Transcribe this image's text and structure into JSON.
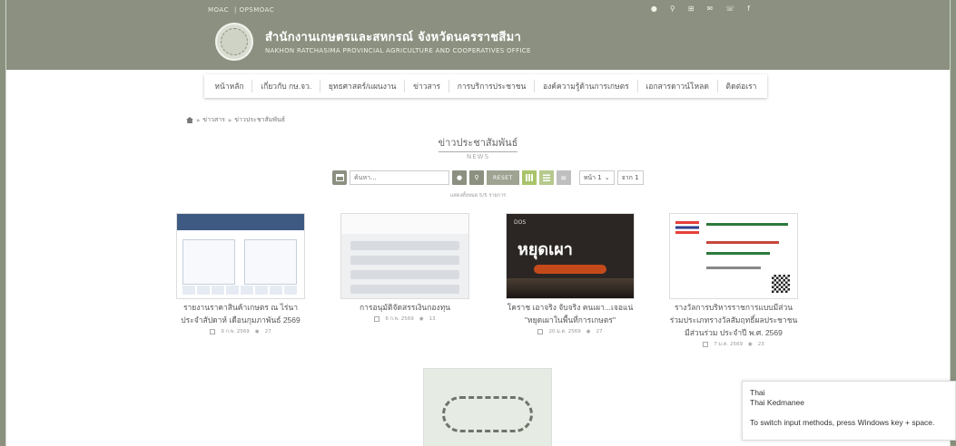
{
  "header": {
    "top_links": [
      "MOAC",
      "OPSMOAC"
    ],
    "title": "สำนักงานเกษตรและสหกรณ์ จังหวัดนครราชสีมา",
    "subtitle": "NAKHON RATCHASIMA PROVINCIAL AGRICULTURE AND COOPERATIVES OFFICE"
  },
  "nav": {
    "items": [
      "หน้าหลัก",
      "เกี่ยวกับ กษ.จว.",
      "ยุทธศาสตร์/แผนงาน",
      "ข่าวสาร",
      "การบริการประชาชน",
      "องค์ความรู้ด้านการเกษตร",
      "เอกสารดาวน์โหลด",
      "ติดต่อเรา"
    ]
  },
  "breadcrumb": {
    "items": [
      "ข่าวสาร",
      "ข่าวประชาสัมพันธ์"
    ]
  },
  "section": {
    "title": "ข่าวประชาสัมพันธ์",
    "subtitle": "NEWS"
  },
  "filters": {
    "search_placeholder": "ค้นหา...",
    "reset_label": "RESET",
    "page_select": "หน้า 1",
    "page_total": "จาก 1",
    "count_text": "แสดงทั้งหมด 5/5 รายการ"
  },
  "cards": [
    {
      "title_line1": "รายงานราคาสินค้าเกษตร ณ ไร่นา",
      "title_line2": "ประจำสัปดาห์ เดือนกุมภาพันธ์ 2569",
      "title_line3": "",
      "date": "9 ก.พ. 2569",
      "views": "27"
    },
    {
      "title_line1": "การอนุมัติจัดสรรเงินกองทุน",
      "title_line2": "",
      "title_line3": "",
      "date": "6 ก.พ. 2569",
      "views": "13"
    },
    {
      "title_line1": "โคราช เอาจริง จับจริง คนเผา...เจอแน่",
      "title_line2": "\"หยุดเผาในพื้นที่การเกษตร\"",
      "title_line3": "",
      "date": "20 ม.ค. 2569",
      "views": "27"
    },
    {
      "title_line1": "รางวัลการบริหารราชการแบบมีส่วน",
      "title_line2": "ร่วมประเภทรางวัลสัมฤทธิ์ผลประชาชน",
      "title_line3": "มีส่วนร่วม ประจำปี พ.ศ. 2569",
      "date": "7 ม.ค. 2569",
      "views": "23"
    }
  ],
  "card3_overlay": {
    "headline": "หยุดเผา",
    "badge": "DOS"
  },
  "ime_popup": {
    "line1": "Thai",
    "line2": "Thai Kedmanee",
    "line3": "To switch input methods, press Windows key + space."
  },
  "colors": {
    "header_bg": "#8b9080",
    "accent_green": "#a9c46b"
  }
}
